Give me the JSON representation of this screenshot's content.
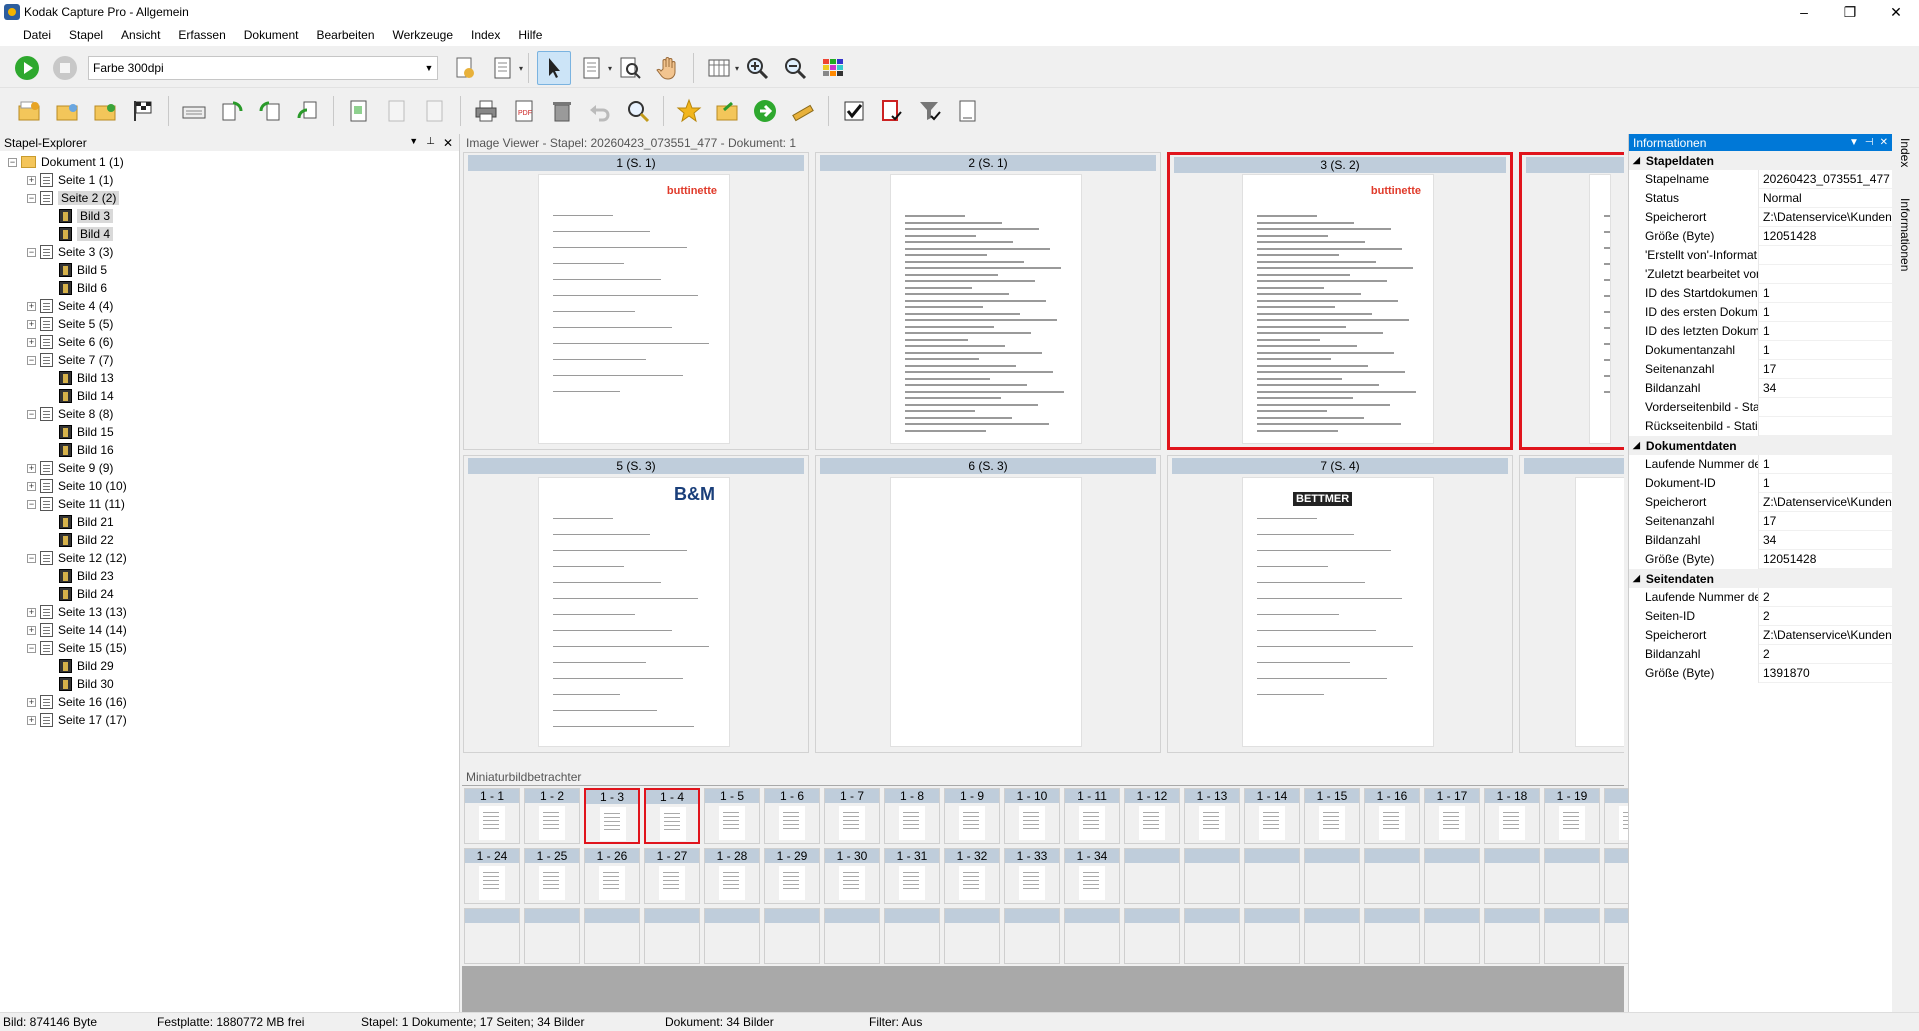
{
  "window": {
    "title": "Kodak Capture Pro - Allgemein",
    "minimize": "–",
    "maximize": "❐",
    "close": "✕"
  },
  "menu": [
    "Datei",
    "Stapel",
    "Ansicht",
    "Erfassen",
    "Dokument",
    "Bearbeiten",
    "Werkzeuge",
    "Index",
    "Hilfe"
  ],
  "toolbar": {
    "profile": "Farbe 300dpi"
  },
  "explorer": {
    "title": "Stapel-Explorer",
    "pin": "📌",
    "close": "✕",
    "nodes": [
      {
        "level": 0,
        "type": "folder",
        "label": "Dokument 1 (1)",
        "exp": "-"
      },
      {
        "level": 1,
        "type": "page",
        "label": "Seite 1 (1)",
        "exp": "+"
      },
      {
        "level": 1,
        "type": "page",
        "label": "Seite 2 (2)",
        "exp": "-",
        "sel": true
      },
      {
        "level": 2,
        "type": "img",
        "label": "Bild 3",
        "sel": true
      },
      {
        "level": 2,
        "type": "img",
        "label": "Bild 4",
        "sel": true
      },
      {
        "level": 1,
        "type": "page",
        "label": "Seite 3 (3)",
        "exp": "-"
      },
      {
        "level": 2,
        "type": "img",
        "label": "Bild 5"
      },
      {
        "level": 2,
        "type": "img",
        "label": "Bild 6"
      },
      {
        "level": 1,
        "type": "page",
        "label": "Seite 4 (4)",
        "exp": "+"
      },
      {
        "level": 1,
        "type": "page",
        "label": "Seite 5 (5)",
        "exp": "+"
      },
      {
        "level": 1,
        "type": "page",
        "label": "Seite 6 (6)",
        "exp": "+"
      },
      {
        "level": 1,
        "type": "page",
        "label": "Seite 7 (7)",
        "exp": "-"
      },
      {
        "level": 2,
        "type": "img",
        "label": "Bild 13"
      },
      {
        "level": 2,
        "type": "img",
        "label": "Bild 14"
      },
      {
        "level": 1,
        "type": "page",
        "label": "Seite 8 (8)",
        "exp": "-"
      },
      {
        "level": 2,
        "type": "img",
        "label": "Bild 15"
      },
      {
        "level": 2,
        "type": "img",
        "label": "Bild 16"
      },
      {
        "level": 1,
        "type": "page",
        "label": "Seite 9 (9)",
        "exp": "+"
      },
      {
        "level": 1,
        "type": "page",
        "label": "Seite 10 (10)",
        "exp": "+"
      },
      {
        "level": 1,
        "type": "page",
        "label": "Seite 11 (11)",
        "exp": "-"
      },
      {
        "level": 2,
        "type": "img",
        "label": "Bild 21"
      },
      {
        "level": 2,
        "type": "img",
        "label": "Bild 22"
      },
      {
        "level": 1,
        "type": "page",
        "label": "Seite 12 (12)",
        "exp": "-"
      },
      {
        "level": 2,
        "type": "img",
        "label": "Bild 23"
      },
      {
        "level": 2,
        "type": "img",
        "label": "Bild 24"
      },
      {
        "level": 1,
        "type": "page",
        "label": "Seite 13 (13)",
        "exp": "+"
      },
      {
        "level": 1,
        "type": "page",
        "label": "Seite 14 (14)",
        "exp": "+"
      },
      {
        "level": 1,
        "type": "page",
        "label": "Seite 15 (15)",
        "exp": "-"
      },
      {
        "level": 2,
        "type": "img",
        "label": "Bild 29"
      },
      {
        "level": 2,
        "type": "img",
        "label": "Bild 30"
      },
      {
        "level": 1,
        "type": "page",
        "label": "Seite 16 (16)",
        "exp": "+"
      },
      {
        "level": 1,
        "type": "page",
        "label": "Seite 17 (17)",
        "exp": "+"
      }
    ]
  },
  "viewer": {
    "title": "Image Viewer - Stapel: 20260423_073551_477 - Dokument: 1",
    "cells": [
      {
        "label": "1 (S. 1)",
        "selected": false,
        "logo": "buttinette"
      },
      {
        "label": "2 (S. 1)",
        "selected": false,
        "logo": ""
      },
      {
        "label": "3 (S. 2)",
        "selected": true,
        "logo": "buttinette"
      },
      {
        "label": "",
        "selected": true,
        "logo": ""
      },
      {
        "label": "5 (S. 3)",
        "selected": false,
        "logo": "B&M"
      },
      {
        "label": "6 (S. 3)",
        "selected": false,
        "logo": ""
      },
      {
        "label": "7 (S. 4)",
        "selected": false,
        "logo": "BETTMER"
      },
      {
        "label": "",
        "selected": false,
        "logo": ""
      }
    ]
  },
  "mini": {
    "title": "Miniaturbildbetrachter",
    "row1": [
      "1 - 1",
      "1 - 2",
      "1 - 3",
      "1 - 4",
      "1 - 5",
      "1 - 6",
      "1 - 7",
      "1 - 8",
      "1 - 9",
      "1 - 10",
      "1 - 11",
      "1 - 12",
      "1 - 13",
      "1 - 14",
      "1 - 15",
      "1 - 16",
      "1 - 17",
      "1 - 18",
      "1 - 19",
      "1"
    ],
    "row2": [
      "1 - 24",
      "1 - 25",
      "1 - 26",
      "1 - 27",
      "1 - 28",
      "1 - 29",
      "1 - 30",
      "1 - 31",
      "1 - 32",
      "1 - 33",
      "1 - 34"
    ],
    "red": [
      "1 - 3",
      "1 - 4"
    ]
  },
  "info": {
    "title": "Informationen",
    "sections": [
      {
        "name": "Stapeldaten",
        "rows": [
          [
            "Stapelname",
            "20260423_073551_477"
          ],
          [
            "Status",
            "Normal"
          ],
          [
            "Speicherort",
            "Z:\\Datenservice\\Kunden"
          ],
          [
            "Größe (Byte)",
            "12051428"
          ],
          [
            "'Erstellt von'-Informat",
            ""
          ],
          [
            "'Zuletzt bearbeitet von",
            ""
          ],
          [
            "ID des Startdokument",
            "1"
          ],
          [
            "ID des ersten Dokume",
            "1"
          ],
          [
            "ID des letzten Dokum",
            "1"
          ],
          [
            "Dokumentanzahl",
            "1"
          ],
          [
            "Seitenanzahl",
            "17"
          ],
          [
            "Bildanzahl",
            "34"
          ],
          [
            "Vorderseitenbild - Sta",
            ""
          ],
          [
            "Rückseitenbild - Statis",
            ""
          ]
        ]
      },
      {
        "name": "Dokumentdaten",
        "rows": [
          [
            "Laufende Nummer de",
            "1"
          ],
          [
            "Dokument-ID",
            "1"
          ],
          [
            "Speicherort",
            "Z:\\Datenservice\\Kunden"
          ],
          [
            "Seitenanzahl",
            "17"
          ],
          [
            "Bildanzahl",
            "34"
          ],
          [
            "Größe (Byte)",
            "12051428"
          ]
        ]
      },
      {
        "name": "Seitendaten",
        "rows": [
          [
            "Laufende Nummer de",
            "2"
          ],
          [
            "Seiten-ID",
            "2"
          ],
          [
            "Speicherort",
            "Z:\\Datenservice\\Kunden"
          ],
          [
            "Bildanzahl",
            "2"
          ],
          [
            "Größe (Byte)",
            "1391870"
          ]
        ]
      }
    ]
  },
  "sidetabs": {
    "index": "Index",
    "info": "Informationen"
  },
  "status": {
    "bild": "Bild: 874146 Byte",
    "festplatte": "Festplatte: 1880772 MB frei",
    "stapel": "Stapel: 1 Dokumente; 17 Seiten; 34 Bilder",
    "dokument": "Dokument: 34 Bilder",
    "filter": "Filter: Aus"
  }
}
